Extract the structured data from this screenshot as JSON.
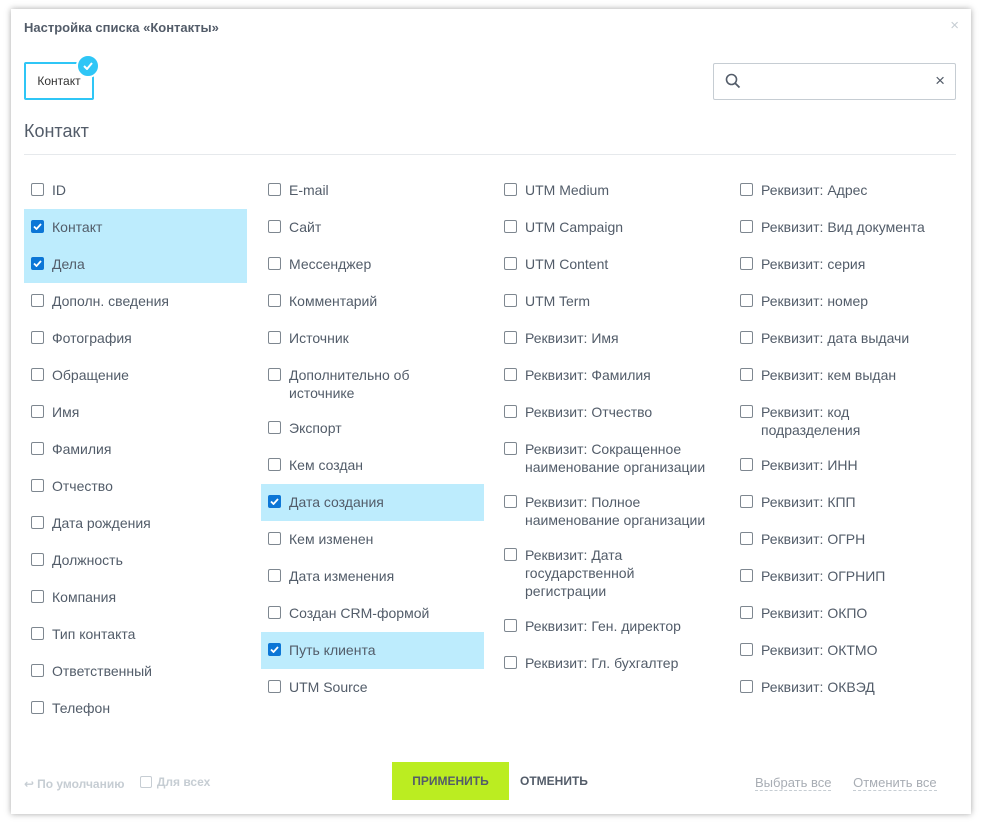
{
  "dialog": {
    "title": "Настройка списка «Контакты»",
    "close_label": "×"
  },
  "tag": {
    "label": "Контакт"
  },
  "search": {
    "value": "",
    "placeholder": "",
    "clear_label": "×"
  },
  "section": {
    "title": "Контакт"
  },
  "columns": [
    [
      {
        "label": "ID",
        "checked": false
      },
      {
        "label": "Контакт",
        "checked": true
      },
      {
        "label": "Дела",
        "checked": true
      },
      {
        "label": "Дополн. сведения",
        "checked": false
      },
      {
        "label": "Фотография",
        "checked": false
      },
      {
        "label": "Обращение",
        "checked": false
      },
      {
        "label": "Имя",
        "checked": false
      },
      {
        "label": "Фамилия",
        "checked": false
      },
      {
        "label": "Отчество",
        "checked": false
      },
      {
        "label": "Дата рождения",
        "checked": false
      },
      {
        "label": "Должность",
        "checked": false
      },
      {
        "label": "Компания",
        "checked": false
      },
      {
        "label": "Тип контакта",
        "checked": false
      },
      {
        "label": "Ответственный",
        "checked": false
      },
      {
        "label": "Телефон",
        "checked": false
      }
    ],
    [
      {
        "label": "E-mail",
        "checked": false
      },
      {
        "label": "Сайт",
        "checked": false
      },
      {
        "label": "Мессенджер",
        "checked": false
      },
      {
        "label": "Комментарий",
        "checked": false
      },
      {
        "label": "Источник",
        "checked": false
      },
      {
        "label": "Дополнительно об источнике",
        "checked": false
      },
      {
        "label": "Экспорт",
        "checked": false
      },
      {
        "label": "Кем создан",
        "checked": false
      },
      {
        "label": "Дата создания",
        "checked": true
      },
      {
        "label": "Кем изменен",
        "checked": false
      },
      {
        "label": "Дата изменения",
        "checked": false
      },
      {
        "label": "Создан CRM-формой",
        "checked": false
      },
      {
        "label": "Путь клиента",
        "checked": true
      },
      {
        "label": "UTM Source",
        "checked": false
      }
    ],
    [
      {
        "label": "UTM Medium",
        "checked": false
      },
      {
        "label": "UTM Campaign",
        "checked": false
      },
      {
        "label": "UTM Content",
        "checked": false
      },
      {
        "label": "UTM Term",
        "checked": false
      },
      {
        "label": "Реквизит: Имя",
        "checked": false
      },
      {
        "label": "Реквизит: Фамилия",
        "checked": false
      },
      {
        "label": "Реквизит: Отчество",
        "checked": false
      },
      {
        "label": "Реквизит: Сокращенное наименование организации",
        "checked": false
      },
      {
        "label": "Реквизит: Полное наименование организации",
        "checked": false
      },
      {
        "label": "Реквизит: Дата государственной регистрации",
        "checked": false
      },
      {
        "label": "Реквизит: Ген. директор",
        "checked": false
      },
      {
        "label": "Реквизит: Гл. бухгалтер",
        "checked": false
      }
    ],
    [
      {
        "label": "Реквизит: Адрес",
        "checked": false
      },
      {
        "label": "Реквизит: Вид документа",
        "checked": false
      },
      {
        "label": "Реквизит: серия",
        "checked": false
      },
      {
        "label": "Реквизит: номер",
        "checked": false
      },
      {
        "label": "Реквизит: дата выдачи",
        "checked": false
      },
      {
        "label": "Реквизит: кем выдан",
        "checked": false
      },
      {
        "label": "Реквизит: код подразделения",
        "checked": false
      },
      {
        "label": "Реквизит: ИНН",
        "checked": false
      },
      {
        "label": "Реквизит: КПП",
        "checked": false
      },
      {
        "label": "Реквизит: ОГРН",
        "checked": false
      },
      {
        "label": "Реквизит: ОГРНИП",
        "checked": false
      },
      {
        "label": "Реквизит: ОКПО",
        "checked": false
      },
      {
        "label": "Реквизит: ОКТМО",
        "checked": false
      },
      {
        "label": "Реквизит: ОКВЭД",
        "checked": false
      }
    ]
  ],
  "footer": {
    "default_label": "По умолчанию",
    "for_all_label": "Для всех",
    "apply_label": "ПРИМЕНИТЬ",
    "cancel_label": "ОТМЕНИТЬ",
    "select_all_label": "Выбрать все",
    "deselect_all_label": "Отменить все"
  },
  "colors": {
    "accent": "#2fc6f6",
    "checked_bg": "#bdecfd",
    "apply": "#bbed21",
    "checkbox": "#0c76d6"
  },
  "icons": {
    "search": "search-icon",
    "close": "close-icon",
    "check": "check-icon",
    "return": "return-arrow-icon"
  }
}
